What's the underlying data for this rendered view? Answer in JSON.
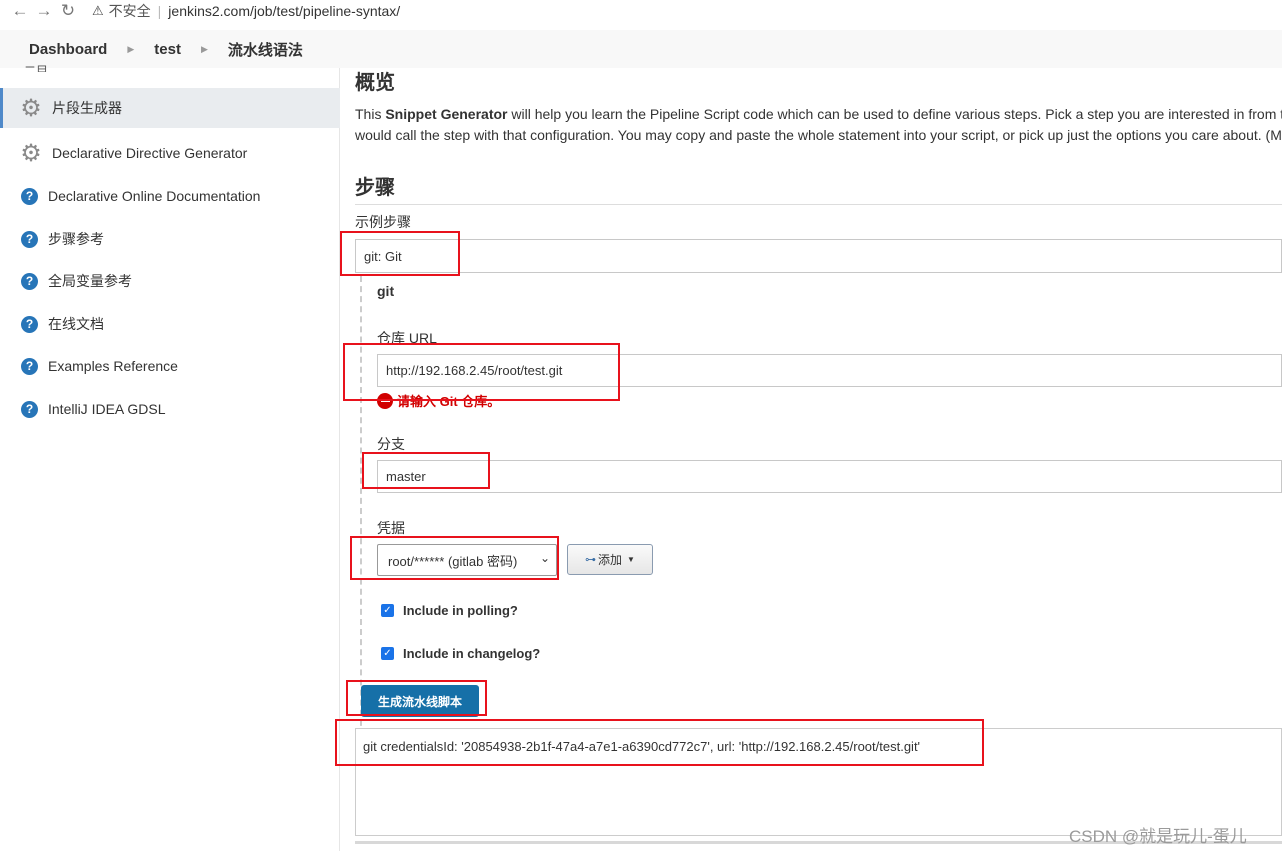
{
  "browser": {
    "back_icon": "←",
    "forward_icon": "→",
    "reload_icon": "↻",
    "warn_icon": "⚠",
    "insecure_label": "不安全",
    "url": "jenkins2.com/job/test/pipeline-syntax/"
  },
  "breadcrumb": {
    "items": [
      "Dashboard",
      "test",
      "流水线语法"
    ]
  },
  "sidebar": {
    "cut_label": "二目",
    "items": [
      {
        "label": "片段生成器"
      },
      {
        "label": "Declarative Directive Generator"
      },
      {
        "label": "Declarative Online Documentation"
      },
      {
        "label": "步骤参考"
      },
      {
        "label": "全局变量参考"
      },
      {
        "label": "在线文档"
      },
      {
        "label": "Examples Reference"
      },
      {
        "label": "IntelliJ IDEA GDSL"
      }
    ]
  },
  "main": {
    "overview_title": "概览",
    "desc_line1_pre": "This ",
    "desc_line1_bold": "Snippet Generator",
    "desc_line1_post": " will help you learn the Pipeline Script code which can be used to define various steps. Pick a step you are interested in from th",
    "desc_line2": "would call the step with that configuration. You may copy and paste the whole statement into your script, or pick up just the options you care about. (M",
    "steps_title": "步骤",
    "sample_step_label": "示例步骤",
    "sample_step_value": "git: Git",
    "git_label": "git",
    "repo_url_label": "仓库 URL",
    "repo_url_value": "http://192.168.2.45/root/test.git",
    "repo_error": "请输入 Git 仓库。",
    "branch_label": "分支",
    "branch_value": "master",
    "credentials_label": "凭据",
    "credentials_value": "root/****** (gitlab 密码)",
    "add_button": "添加",
    "include_polling": "Include in polling?",
    "include_changelog": "Include in changelog?",
    "generate_button": "生成流水线脚本",
    "output": "git credentialsId: '20854938-2b1f-47a4-a7e1-a6390cd772c7', url: 'http://192.168.2.45/root/test.git'"
  },
  "watermark": "CSDN @就是玩儿-蛋儿",
  "colors": {
    "accent": "#1670a8",
    "error": "#d10000",
    "annotation": "#e8121c",
    "help_icon": "#2775b8"
  }
}
